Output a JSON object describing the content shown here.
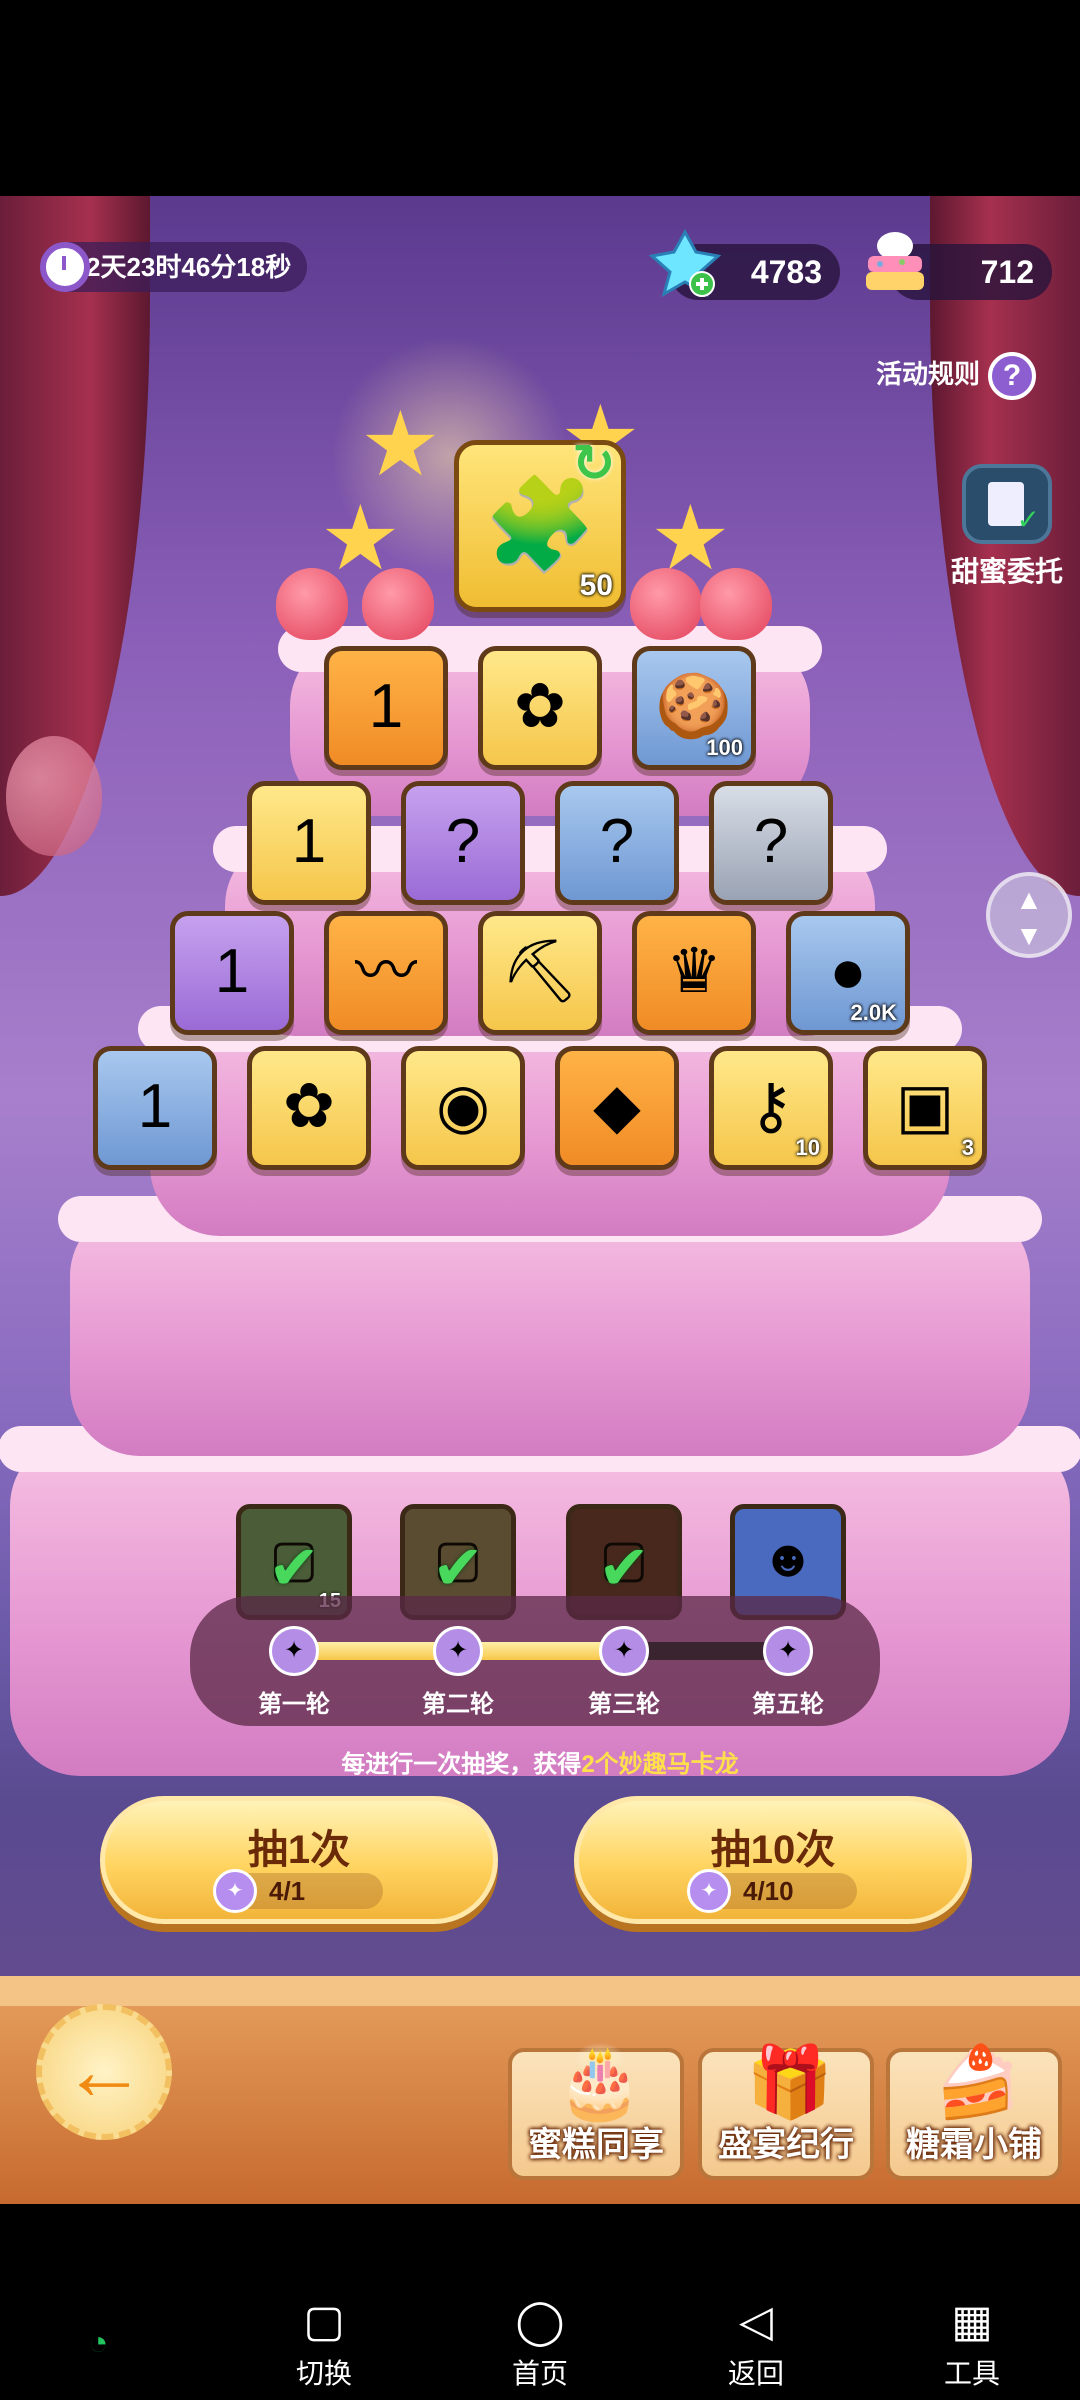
{
  "event": {
    "timer": "2天23时46分18秒",
    "gems": "4783",
    "cake_currency": "712",
    "rules_label": "活动规则",
    "commission_label": "甜蜜委托"
  },
  "top_prize": {
    "icon": "paw-puzzle-icon",
    "qty": "50"
  },
  "tiers": [
    [
      {
        "icon": "chest-icon",
        "glyph": "1",
        "color": "orange",
        "qty": ""
      },
      {
        "icon": "flower-icon",
        "glyph": "✿",
        "color": "gold",
        "qty": ""
      },
      {
        "icon": "cookies-icon",
        "glyph": "🍪",
        "color": "blue",
        "qty": "100"
      }
    ],
    [
      {
        "icon": "chest-icon",
        "glyph": "1",
        "color": "gold",
        "qty": ""
      },
      {
        "icon": "mystery-bag-icon",
        "glyph": "?",
        "color": "purple",
        "qty": ""
      },
      {
        "icon": "mystery-bag-icon",
        "glyph": "?",
        "color": "blue",
        "qty": ""
      },
      {
        "icon": "mystery-bag-icon",
        "glyph": "?",
        "color": "grey",
        "qty": ""
      }
    ],
    [
      {
        "icon": "chest-icon",
        "glyph": "1",
        "color": "purple",
        "qty": ""
      },
      {
        "icon": "hair-icon",
        "glyph": "〰",
        "color": "orange",
        "qty": ""
      },
      {
        "icon": "pickaxe-icon",
        "glyph": "⛏",
        "color": "gold",
        "qty": ""
      },
      {
        "icon": "crown-bag-icon",
        "glyph": "♛",
        "color": "orange",
        "qty": ""
      },
      {
        "icon": "coin-icon",
        "glyph": "●",
        "color": "blue",
        "qty": "2.0K"
      }
    ],
    [
      {
        "icon": "chest-icon",
        "glyph": "1",
        "color": "blue",
        "qty": ""
      },
      {
        "icon": "flower-icon",
        "glyph": "✿",
        "color": "gold",
        "qty": ""
      },
      {
        "icon": "orb-icon",
        "glyph": "◉",
        "color": "gold",
        "qty": ""
      },
      {
        "icon": "crystal-icon",
        "glyph": "◆",
        "color": "orange",
        "qty": ""
      },
      {
        "icon": "key-icon",
        "glyph": "⚷",
        "color": "gold",
        "qty": "10"
      },
      {
        "icon": "treasure-chest-icon",
        "glyph": "▣",
        "color": "gold",
        "qty": "3"
      }
    ]
  ],
  "rounds": [
    {
      "label": "第一轮",
      "done": true,
      "qty": "15"
    },
    {
      "label": "第二轮",
      "done": true,
      "qty": ""
    },
    {
      "label": "第三轮",
      "done": true,
      "qty": ""
    },
    {
      "label": "第五轮",
      "done": false,
      "qty": ""
    }
  ],
  "round_progress": 0.7,
  "note_prefix": "每进行一次抽奖，获得",
  "note_highlight": "2个妙趣马卡龙",
  "draw_buttons": [
    {
      "label": "抽1次",
      "cost": "4/1"
    },
    {
      "label": "抽10次",
      "cost": "4/10"
    }
  ],
  "tabs": [
    {
      "label": "蜜糕同享",
      "icon": "cake-share-icon"
    },
    {
      "label": "盛宴纪行",
      "icon": "gift-box-icon"
    },
    {
      "label": "糖霜小铺",
      "icon": "cake-shop-icon"
    }
  ],
  "system_nav": {
    "switch": "切换",
    "home": "首页",
    "back": "返回",
    "tools": "工具"
  },
  "colors": {
    "accent": "#f5c64a",
    "progress": "#f7c74a",
    "check": "#47d85c"
  }
}
